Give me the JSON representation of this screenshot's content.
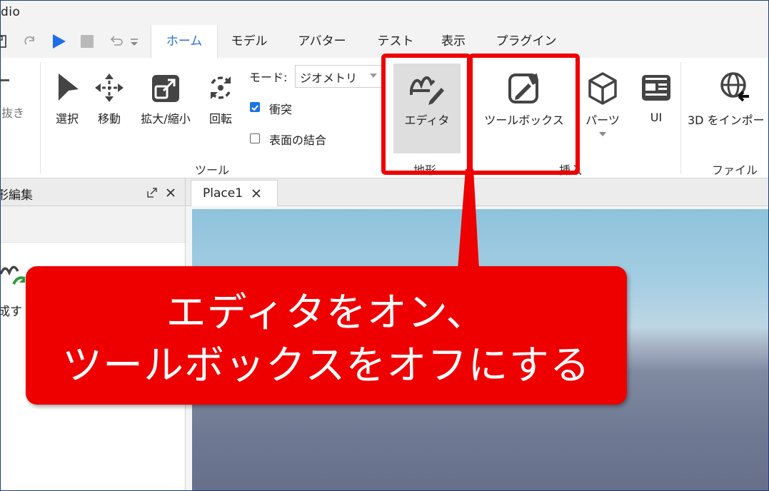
{
  "window": {
    "title": "dio"
  },
  "tabs": [
    {
      "label": "ホーム",
      "active": true
    },
    {
      "label": "モデル",
      "active": false
    },
    {
      "label": "アバター",
      "active": false
    },
    {
      "label": "テスト",
      "active": false
    },
    {
      "label": "表示",
      "active": false
    },
    {
      "label": "プラグイン",
      "active": false
    }
  ],
  "ribbon": {
    "cut_tool_label": "抜き",
    "tools": {
      "select": "選択",
      "move": "移動",
      "scale": "拡大/縮小",
      "rotate": "回転"
    },
    "mode_label": "モード:",
    "mode_value": "ジオメトリ",
    "collision_label": "衝突",
    "collision_checked": true,
    "join_surfaces_label": "表面の結合",
    "join_surfaces_checked": false,
    "tools_group_label": "ツール",
    "editor_label": "エディタ",
    "terrain_group_label": "地形",
    "toolbox_label": "ツールボックス",
    "parts_label": "パーツ",
    "ui_label": "UI",
    "insert_group_label": "挿入",
    "import3d_label": "3D をインポー",
    "file_group_label": "ファイル"
  },
  "left_panel": {
    "title": "形編集",
    "partial_text": "成す"
  },
  "doc_tab": {
    "label": "Place1"
  },
  "callout": {
    "line1": "エディタをオン、",
    "line2": "ツールボックスをオフにする"
  },
  "colors": {
    "accent_blue": "#2a6fd6",
    "play_blue": "#1e6ee8",
    "highlight_red": "#ee0000",
    "callout_text": "#ffffff"
  }
}
